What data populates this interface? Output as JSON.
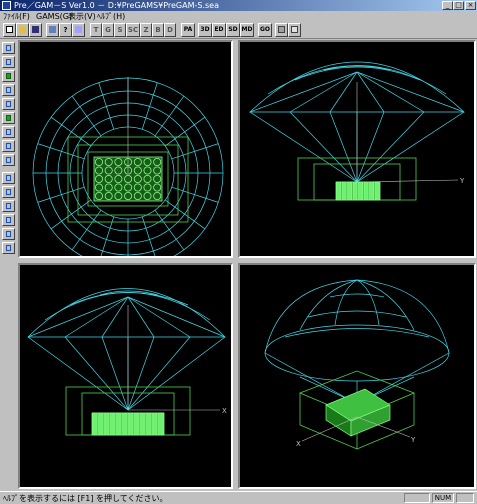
{
  "window": {
    "title": "Pre／GAM－S  Ver1.0  －  D:¥PreGAMS¥PreGAM-S.sea"
  },
  "menu": [
    "ﾌｧｲﾙ(F)",
    "GAMS(G)",
    "表示(V)",
    "ﾍﾙﾌﾟ(H)"
  ],
  "toolbar": {
    "letters": [
      "T",
      "G",
      "S",
      "SC",
      "Z",
      "B",
      "D"
    ],
    "words": [
      "PA",
      "3D",
      "ED",
      "SD",
      "MD",
      "GO"
    ]
  },
  "viewports": {
    "top_right_axis": "Y",
    "bottom_left_axis": "X",
    "bottom_right_axis_x": "X",
    "bottom_right_axis_y": "Y"
  },
  "status": {
    "help_text": "ﾍﾙﾌﾟを表示するには [F1] を押してください。",
    "num": "NUM"
  },
  "colors": {
    "mesh": "#40d8e8",
    "frame": "#50d050",
    "crystal": "#80ff80",
    "axis": "#c0c0c0"
  }
}
